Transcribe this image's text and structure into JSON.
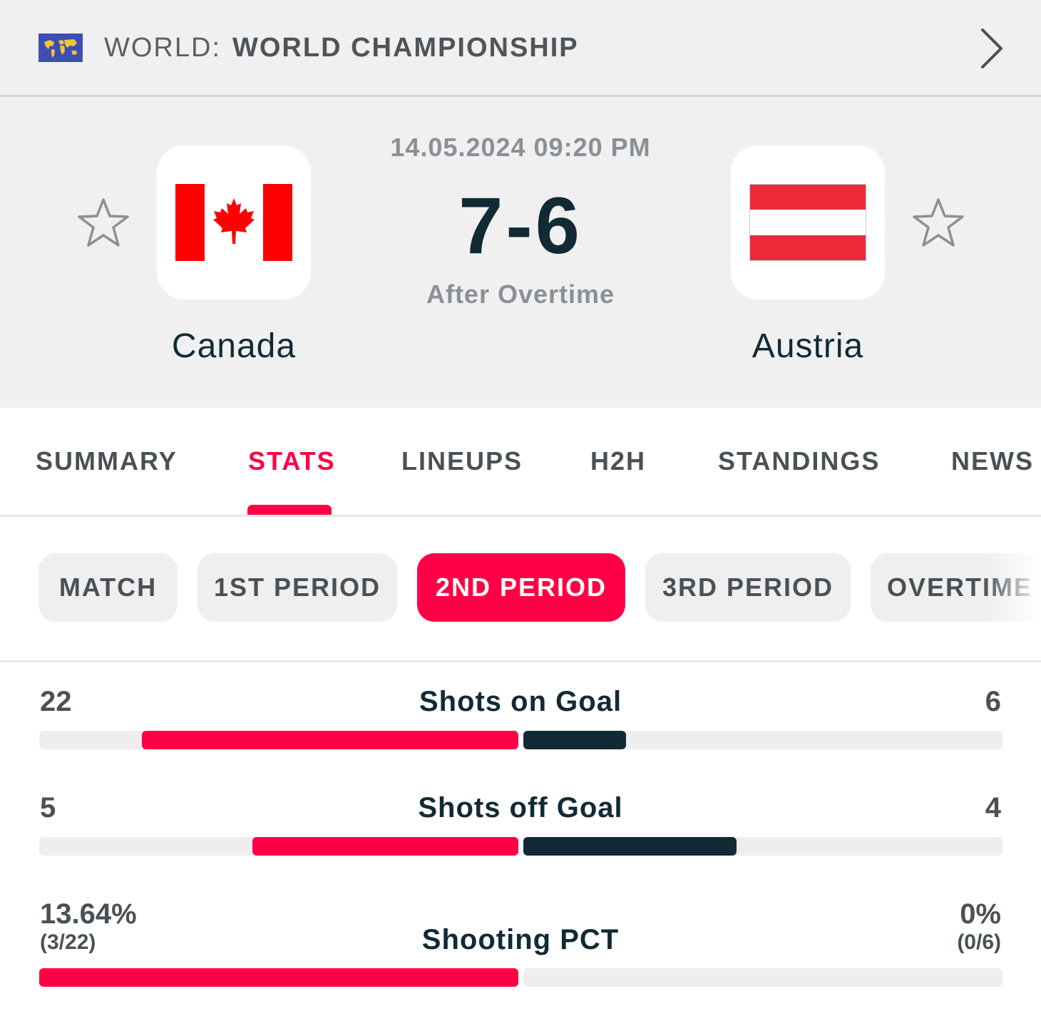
{
  "league": {
    "country": "WORLD:",
    "name": "WORLD CHAMPIONSHIP",
    "flag_icon": "world-map-flag",
    "chevron_icon": "chevron-right-icon"
  },
  "match": {
    "datetime": "14.05.2024 09:20 PM",
    "score": "7-6",
    "status": "After Overtime",
    "home": {
      "name": "Canada",
      "flag_icon": "canada-flag"
    },
    "away": {
      "name": "Austria",
      "flag_icon": "austria-flag"
    }
  },
  "tabs": [
    {
      "label": "SUMMARY",
      "active": false
    },
    {
      "label": "STATS",
      "active": true
    },
    {
      "label": "LINEUPS",
      "active": false
    },
    {
      "label": "H2H",
      "active": false
    },
    {
      "label": "STANDINGS",
      "active": false
    },
    {
      "label": "NEWS",
      "active": false
    }
  ],
  "periods": [
    {
      "label": "MATCH",
      "active": false
    },
    {
      "label": "1ST PERIOD",
      "active": false
    },
    {
      "label": "2ND PERIOD",
      "active": true
    },
    {
      "label": "3RD PERIOD",
      "active": false
    },
    {
      "label": "OVERTIME",
      "active": false
    }
  ],
  "stats": [
    {
      "label": "Shots on Goal",
      "home": "22",
      "away": "6",
      "home_share": 0.7857,
      "away_share": 0.2143
    },
    {
      "label": "Shots off Goal",
      "home": "5",
      "away": "4",
      "home_share": 0.5556,
      "away_share": 0.4444
    },
    {
      "label": "Shooting PCT",
      "home": "13.64%",
      "home_sub": "(3/22)",
      "away": "0%",
      "away_sub": "(0/6)",
      "home_share": 1.0,
      "away_share": 0.0
    }
  ],
  "colors": {
    "accent": "#ff0046",
    "away_bar": "#112a36",
    "text_dark": "#112a36",
    "text_muted": "#8a9095",
    "header_bg": "#f0f0f0"
  }
}
